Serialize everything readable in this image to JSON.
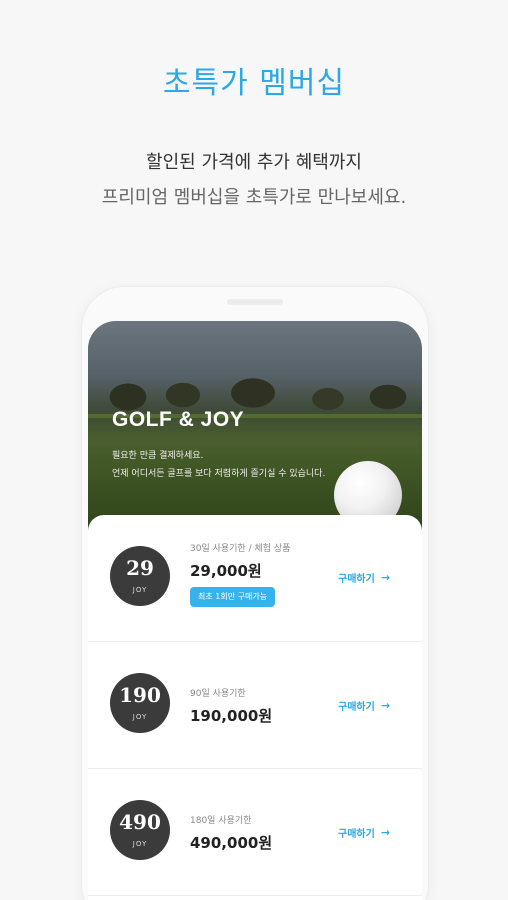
{
  "header": {
    "title": "초특가 멤버십",
    "subtitle_line1": "할인된 가격에 추가 혜택까지",
    "subtitle_line2": "프리미엄 멤버십을 초특가로 만나보세요."
  },
  "hero": {
    "logo": "GOLF & JOY",
    "line1": "필요한 만큼 결제하세요.",
    "line2": "언제 어디서든 골프를 보다 저렴하게 즐기실 수 있습니다."
  },
  "plans": [
    {
      "badge": "29",
      "badge_sub": "JOY",
      "meta": "30일 사용기한 / 체험 상품",
      "price": "29,000원",
      "tag": "최초 1회만 구매가능",
      "buy": "구매하기",
      "arrow": "→"
    },
    {
      "badge": "190",
      "badge_sub": "JOY",
      "meta": "90일 사용기한",
      "price": "190,000원",
      "buy": "구매하기",
      "arrow": "→"
    },
    {
      "badge": "490",
      "badge_sub": "JOY",
      "meta": "180일 사용기한",
      "price": "490,000원",
      "buy": "구매하기",
      "arrow": "→"
    }
  ],
  "colors": {
    "accent": "#2aa8e8",
    "badge": "#3b3b3b",
    "tag": "#38b2ec"
  }
}
